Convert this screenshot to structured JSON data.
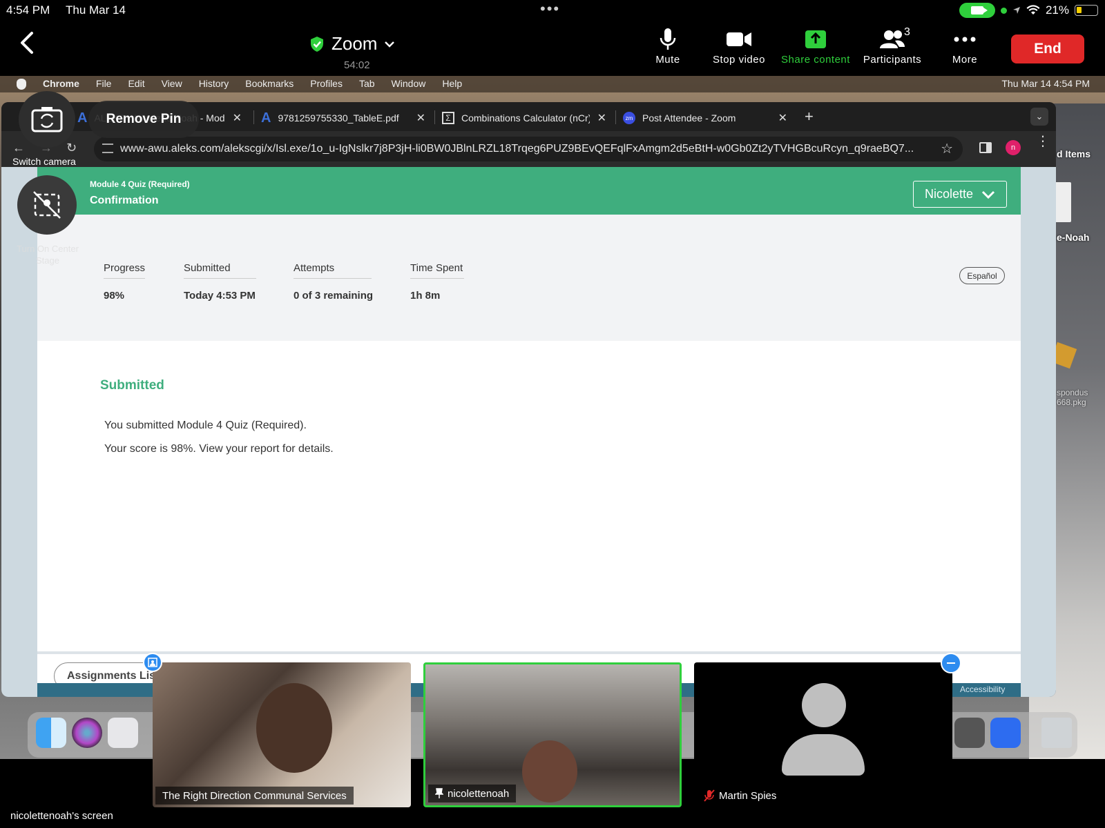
{
  "status_bar": {
    "time": "4:54 PM",
    "date": "Thu Mar 14",
    "battery": "21%"
  },
  "zoom": {
    "title": "Zoom",
    "timer": "54:02",
    "toolbar": {
      "mute": "Mute",
      "stop_video": "Stop video",
      "share_content": "Share content",
      "participants": "Participants",
      "participant_count": "3",
      "more": "More",
      "end": "End"
    },
    "overlay": {
      "switch_camera": "Switch camera",
      "remove_pin": "Remove Pin",
      "center_stage": "Turn On Center Stage"
    },
    "share_label": "nicolettenoah's screen",
    "participants_tiles": [
      {
        "name": "The Right Direction Communal Services"
      },
      {
        "name": "nicolettenoah"
      },
      {
        "name": "Martin Spies"
      }
    ]
  },
  "mac": {
    "menubar": {
      "app": "Chrome",
      "menus": [
        "File",
        "Edit",
        "View",
        "History",
        "Bookmarks",
        "Profiles",
        "Tab",
        "Window",
        "Help"
      ],
      "clock": "Thu Mar 14  4:54 PM"
    },
    "desktop_labels": {
      "items": "d Items",
      "file": "e-Noah",
      "pkg": "spondus\n668.pkg"
    }
  },
  "chrome": {
    "tabs": [
      {
        "title": "ALEKS - Nicolette Noah - Module 4 Quiz"
      },
      {
        "title": "9781259755330_TableE.pdf"
      },
      {
        "title": "Combinations Calculator (nCr)"
      },
      {
        "title": "Post Attendee - Zoom"
      }
    ],
    "url": "www-awu.aleks.com/alekscgi/x/Isl.exe/1o_u-IgNslkr7j8P3jH-li0BW0JBlnLRZL18Trqeg6PUZ9BEvQEFqlFxAmgm2d5eBtH-w0Gb0Zt2yTVHGBcuRcyn_q9raeBQ7...",
    "profile_initial": "n"
  },
  "aleks": {
    "breadcrumb": "Module 4 Quiz (Required)",
    "page_title": "Confirmation",
    "user_name": "Nicolette",
    "language": "Español",
    "stats": [
      {
        "label": "Progress",
        "value": "98%"
      },
      {
        "label": "Submitted",
        "value": "Today 4:53 PM"
      },
      {
        "label": "Attempts",
        "value": "0 of 3 remaining"
      },
      {
        "label": "Time Spent",
        "value": "1h 8m"
      }
    ],
    "submitted_heading": "Submitted",
    "message_line1": "You submitted Module 4 Quiz (Required).",
    "message_line2": "Your score is 98%. View your report for details.",
    "assignments_button": "Assignments List",
    "accessibility": "Accessibility"
  }
}
